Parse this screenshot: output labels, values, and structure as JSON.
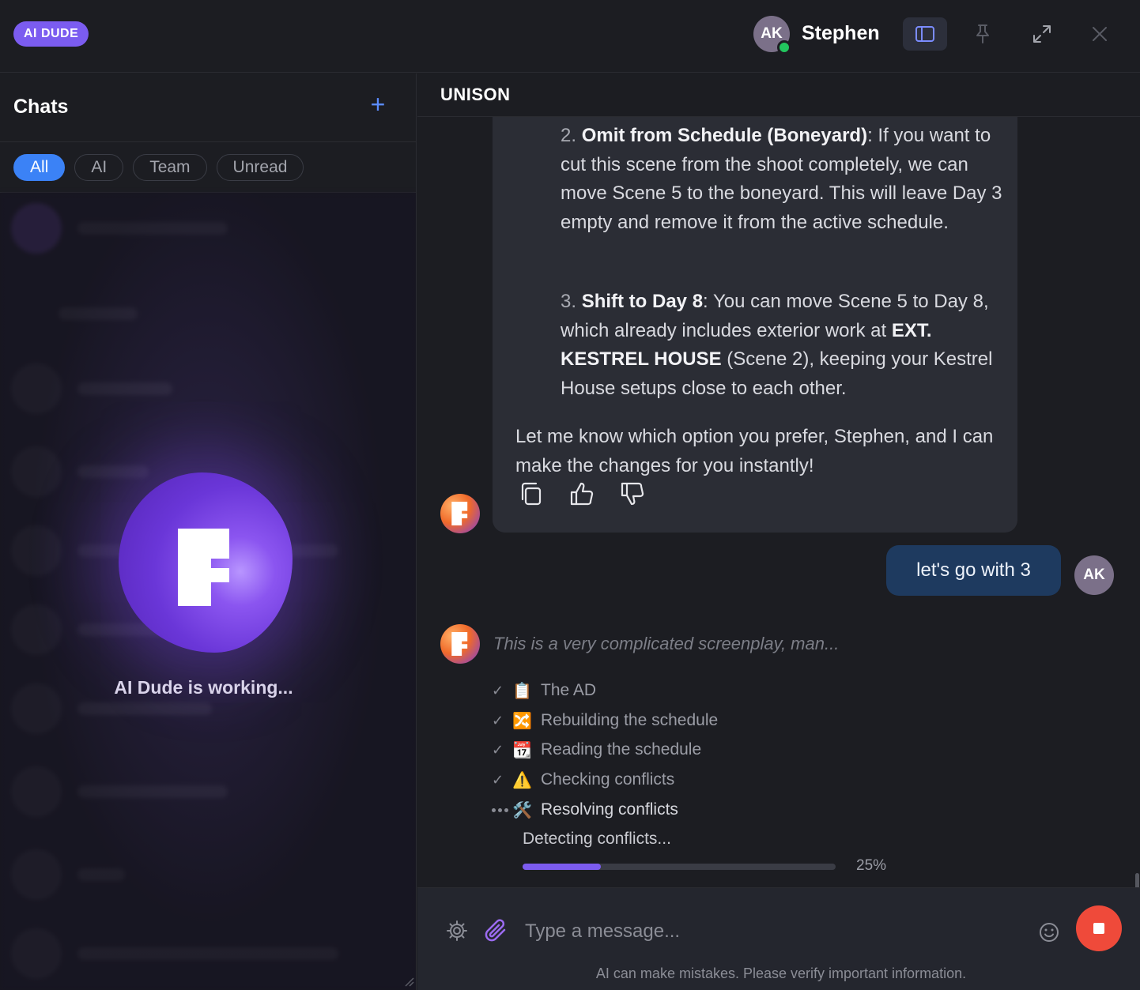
{
  "app": {
    "badge": "AI DUDE"
  },
  "header": {
    "user_initials": "AK",
    "user_name": "Stephen",
    "icons": [
      "sidebar-toggle-icon",
      "pin-icon",
      "expand-icon",
      "close-icon"
    ]
  },
  "sidebar": {
    "title": "Chats",
    "filters": [
      "All",
      "AI",
      "Team",
      "Unread"
    ],
    "active_filter": "All",
    "working_text": "AI Dude is working..."
  },
  "chat": {
    "title": "UNISON",
    "options": [
      {
        "num": "2.",
        "bold": "Omit from Schedule (Boneyard)",
        "rest": ": If you want to cut this scene from the shoot completely, we can move Scene 5 to the boneyard. This will leave Day 3 empty and remove it from the active schedule."
      },
      {
        "num": "3.",
        "bold": "Shift to Day 8",
        "rest_a": ": You can move Scene 5 to Day 8, which already includes exterior work at ",
        "bold2": "EXT. KESTREL HOUSE",
        "rest_b": " (Scene 2), keeping your Kestrel House setups close to each other."
      }
    ],
    "closing": "Let me know which option you prefer, Stephen, and I can make the changes for you instantly!",
    "user_message": "let's go with 3",
    "user_initials": "AK",
    "thinking": "This is a very complicated screenplay, man...",
    "steps": [
      {
        "status": "done",
        "emoji": "📋",
        "label": "The AD"
      },
      {
        "status": "done",
        "emoji": "🔀",
        "label": "Rebuilding the schedule"
      },
      {
        "status": "done",
        "emoji": "📆",
        "label": "Reading the schedule"
      },
      {
        "status": "done",
        "emoji": "⚠️",
        "label": "Checking conflicts"
      },
      {
        "status": "active",
        "emoji": "🛠️",
        "label": "Resolving conflicts"
      }
    ],
    "detecting": "Detecting conflicts...",
    "progress": 0.25,
    "progress_label": "25%"
  },
  "composer": {
    "placeholder": "Type a message...",
    "disclaimer": "AI can make mistakes. Please verify important information."
  },
  "colors": {
    "accent": "#7b5cf0",
    "link_blue": "#3b82f6",
    "stop": "#ef4a3a",
    "online": "#22c55e",
    "user_bubble": "#1e3a5f"
  }
}
